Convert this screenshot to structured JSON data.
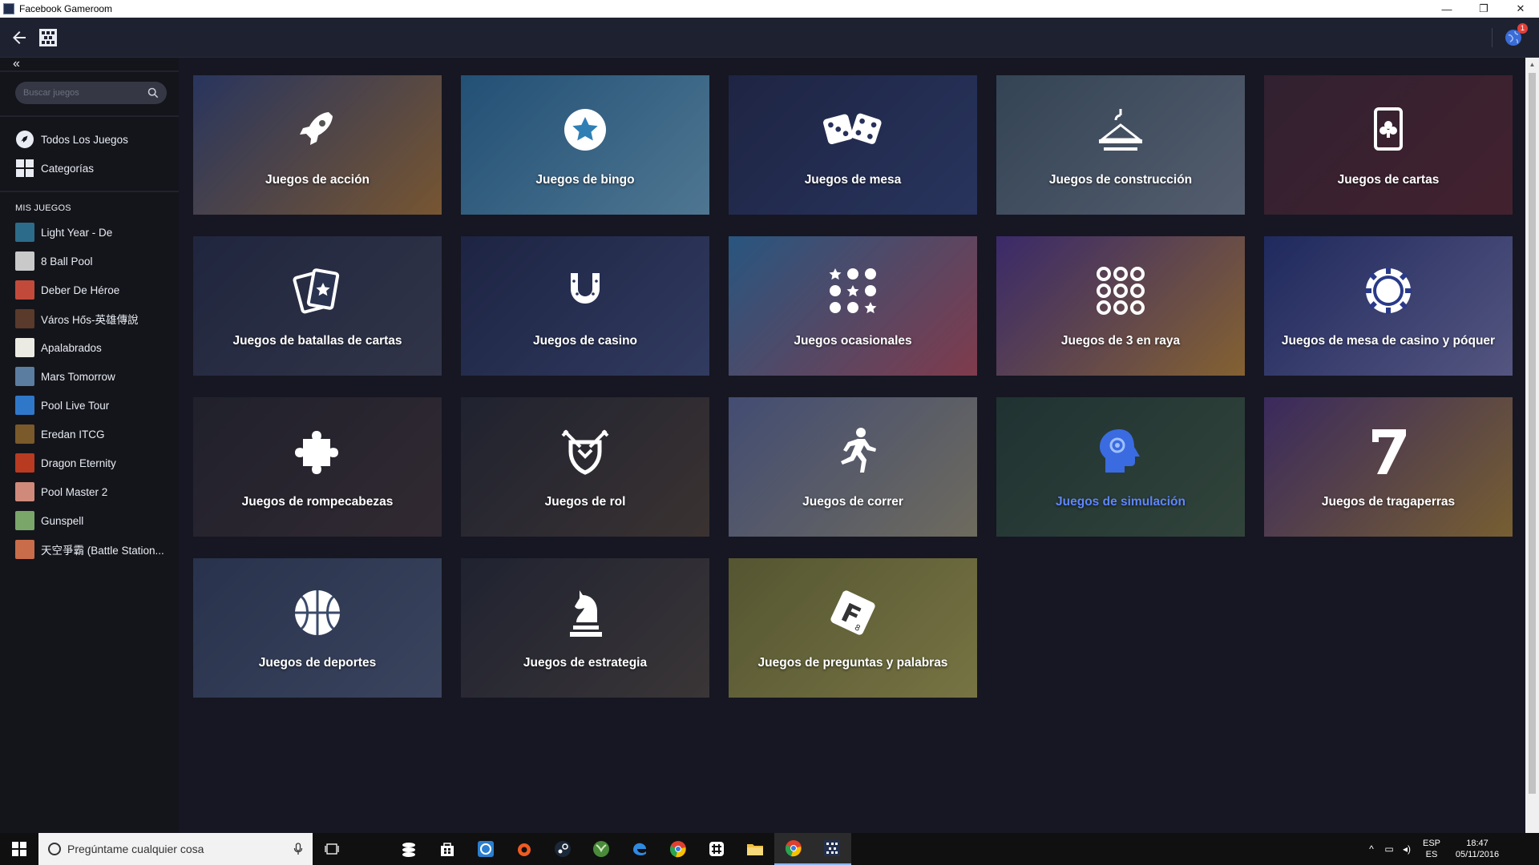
{
  "window": {
    "title": "Facebook Gameroom",
    "minimize": "—",
    "restore": "❐",
    "close": "✕"
  },
  "appbar": {
    "back_icon": "arrow-left-icon",
    "logo_icon": "gameroom-logo-icon",
    "notification_count": "1"
  },
  "sidebar": {
    "collapse_icon": "«",
    "search": {
      "placeholder": "Buscar juegos"
    },
    "nav": [
      {
        "label": "Todos Los Juegos",
        "icon": "rocket-icon"
      },
      {
        "label": "Categorías",
        "icon": "grid-icon"
      }
    ],
    "my_games_title": "MIS JUEGOS",
    "my_games": [
      {
        "label": "Light Year - De",
        "color": "#2c6b8a"
      },
      {
        "label": "8 Ball Pool",
        "color": "#c9c9c9"
      },
      {
        "label": "Deber De Héroe",
        "color": "#c24a3a"
      },
      {
        "label": "Város Hős-英雄傳說",
        "color": "#5a3a2a"
      },
      {
        "label": "Apalabrados",
        "color": "#ecebe3"
      },
      {
        "label": "Mars Tomorrow",
        "color": "#5b7da0"
      },
      {
        "label": "Pool Live Tour",
        "color": "#2f78c9"
      },
      {
        "label": "Eredan ITCG",
        "color": "#7a5a2a"
      },
      {
        "label": "Dragon Eternity",
        "color": "#b83a20"
      },
      {
        "label": "Pool Master 2",
        "color": "#d08a7a"
      },
      {
        "label": "Gunspell",
        "color": "#7aa66a"
      },
      {
        "label": "天空爭霸 (Battle Station...",
        "color": "#c96c4a"
      }
    ]
  },
  "categories": [
    {
      "label": "Juegos de acción",
      "icon": "rocket-icon",
      "bg1": "#3a4f8a",
      "bg2": "#c98a3a"
    },
    {
      "label": "Juegos de bingo",
      "icon": "star-circle-icon",
      "bg1": "#2f7fb5",
      "bg2": "#7fc6e8"
    },
    {
      "label": "Juegos de mesa",
      "icon": "dice-icon",
      "bg1": "#27315a",
      "bg2": "#3a4e8a"
    },
    {
      "label": "Juegos de construcción",
      "icon": "crane-icon",
      "bg1": "#4e6a7a",
      "bg2": "#8a98a8"
    },
    {
      "label": "Juegos de cartas",
      "icon": "card-club-icon",
      "bg1": "#4a2b38",
      "bg2": "#6a2a34"
    },
    {
      "label": "Juegos de batallas de cartas",
      "icon": "cards-star-icon",
      "bg1": "#2a3350",
      "bg2": "#4a4f64"
    },
    {
      "label": "Juegos de casino",
      "icon": "horseshoe-icon",
      "bg1": "#25305a",
      "bg2": "#4a5a8e"
    },
    {
      "label": "Juegos ocasionales",
      "icon": "dots-stars-icon",
      "bg1": "#3a8ac8",
      "bg2": "#d85a6a"
    },
    {
      "label": "Juegos de 3 en raya",
      "icon": "grid-circles-icon",
      "bg1": "#5a3aa0",
      "bg2": "#e0a03a"
    },
    {
      "label": "Juegos de mesa de casino y póquer",
      "icon": "poker-chip-icon",
      "bg1": "#2a3a8a",
      "bg2": "#8a8ac8"
    },
    {
      "label": "Juegos de rompecabezas",
      "icon": "puzzle-icon",
      "bg1": "#2b2a30",
      "bg2": "#4a3a3a"
    },
    {
      "label": "Juegos de rol",
      "icon": "shield-swords-icon",
      "bg1": "#2a2d38",
      "bg2": "#5a4a3a"
    },
    {
      "label": "Juegos de correr",
      "icon": "runner-icon",
      "bg1": "#6a7ab0",
      "bg2": "#b8b08a"
    },
    {
      "label": "Juegos de simulación",
      "icon": "head-gear-icon",
      "bg1": "#2a4a3a",
      "bg2": "#4a6a4a",
      "highlight": true
    },
    {
      "label": "Juegos de tragaperras",
      "icon": "seven-icon",
      "bg1": "#5a3a8a",
      "bg2": "#c89a3a"
    },
    {
      "label": "Juegos de deportes",
      "icon": "basketball-icon",
      "bg1": "#3a4a6a",
      "bg2": "#5a6a8a"
    },
    {
      "label": "Juegos de estrategia",
      "icon": "chess-knight-icon",
      "bg1": "#2a2d38",
      "bg2": "#5a5044"
    },
    {
      "label": "Juegos de preguntas y palabras",
      "icon": "letter-tile-icon",
      "bg1": "#8a8a3a",
      "bg2": "#c8c05a"
    }
  ],
  "taskbar": {
    "search_placeholder": "Pregúntame cualquier cosa",
    "language_top": "ESP",
    "language_bottom": "ES",
    "time": "18:47",
    "date": "05/11/2016"
  }
}
